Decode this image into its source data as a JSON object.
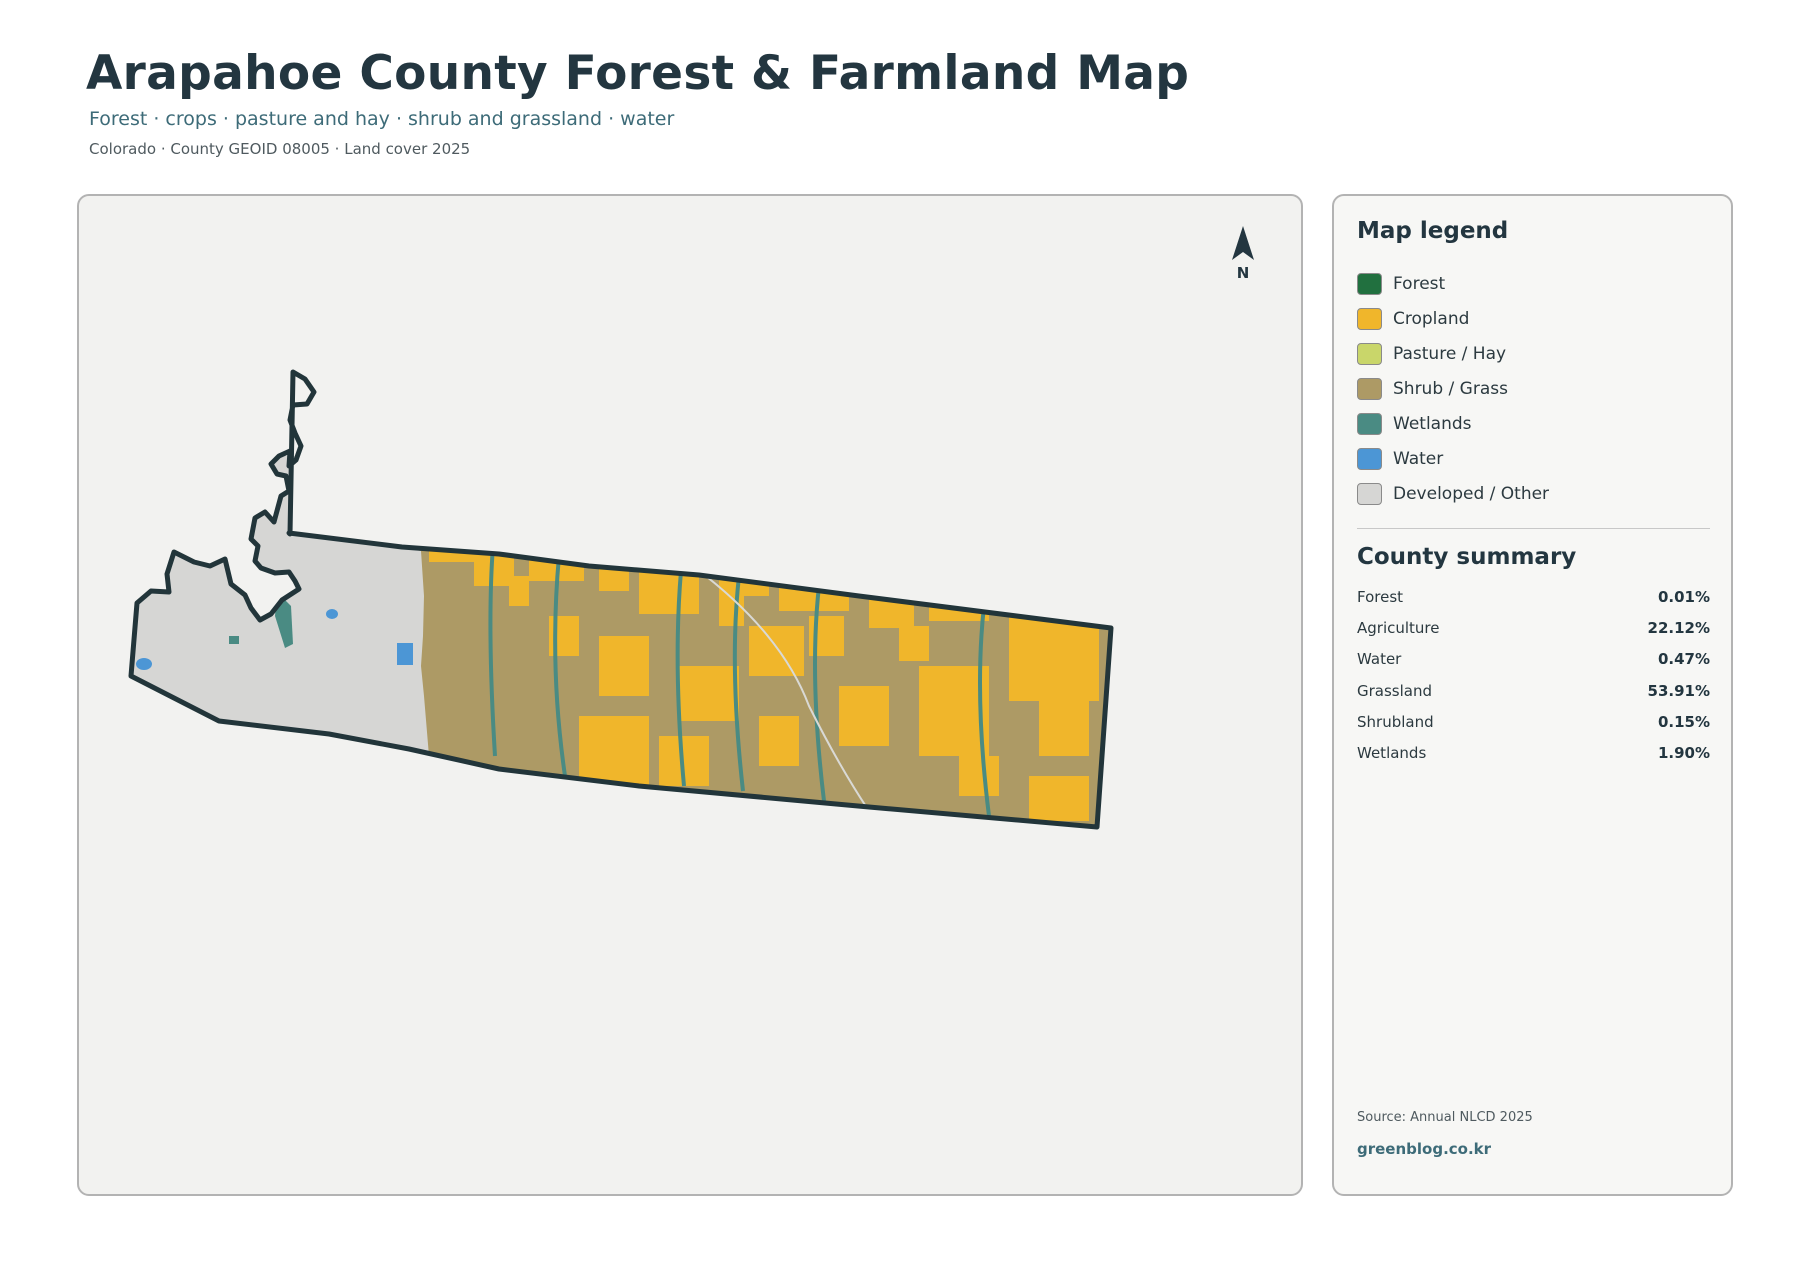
{
  "header": {
    "title": "Arapahoe County Forest & Farmland Map",
    "subtitle": "Forest · crops · pasture and hay · shrub and grassland · water",
    "meta": "Colorado · County GEOID 08005 · Land cover 2025"
  },
  "map": {
    "north_label": "N",
    "boundary_color": "#22353a",
    "background_color": "#f2f2f0"
  },
  "legend": {
    "title": "Map legend",
    "items": [
      {
        "label": "Forest",
        "color": "#21703f"
      },
      {
        "label": "Cropland",
        "color": "#f0b62b"
      },
      {
        "label": "Pasture / Hay",
        "color": "#c9d66a"
      },
      {
        "label": "Shrub / Grass",
        "color": "#ad9a65"
      },
      {
        "label": "Wetlands",
        "color": "#4a8b83"
      },
      {
        "label": "Water",
        "color": "#4c96d5"
      },
      {
        "label": "Developed / Other",
        "color": "#d6d6d4"
      }
    ]
  },
  "summary": {
    "title": "County summary",
    "rows": [
      {
        "label": "Forest",
        "value": "0.01%"
      },
      {
        "label": "Agriculture",
        "value": "22.12%"
      },
      {
        "label": "Water",
        "value": "0.47%"
      },
      {
        "label": "Grassland",
        "value": "53.91%"
      },
      {
        "label": "Shrubland",
        "value": "0.15%"
      },
      {
        "label": "Wetlands",
        "value": "1.90%"
      }
    ]
  },
  "footer": {
    "source": "Source: Annual NLCD 2025",
    "brand": "greenblog.co.kr"
  }
}
